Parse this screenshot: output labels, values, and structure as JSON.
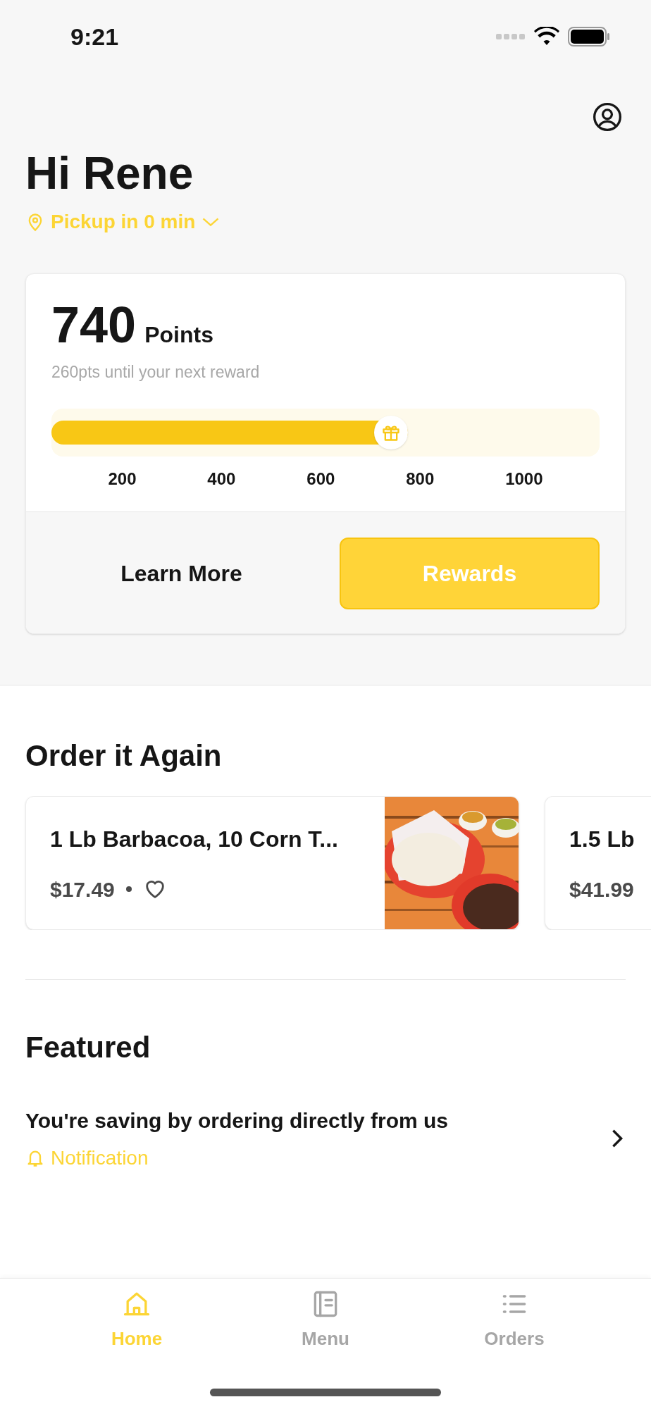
{
  "status_bar": {
    "time": "9:21"
  },
  "greeting": "Hi Rene",
  "pickup": {
    "label": "Pickup in 0 min"
  },
  "rewards_card": {
    "points": "740",
    "points_label": "Points",
    "subtitle": "260pts until your next reward",
    "ticks": [
      "200",
      "400",
      "600",
      "800",
      "1000"
    ],
    "buttons": [
      {
        "label": "Learn More",
        "kind": "plain"
      },
      {
        "label": "Rewards",
        "kind": "primary"
      }
    ]
  },
  "order_again": {
    "title": "Order it Again",
    "items": [
      {
        "name": "1 Lb Barbacoa, 10 Corn T...",
        "price": "$17.49",
        "favorite": false,
        "kind": "picture"
      },
      {
        "name": "1.5 Lb",
        "price": "$41.99"
      }
    ]
  },
  "featured": {
    "title": "Featured",
    "items": [
      {
        "title": "You're saving by ordering directly from us",
        "tag": "Notification"
      }
    ]
  },
  "tab_bar": [
    {
      "label": "Home",
      "selected": true,
      "kind": "home"
    },
    {
      "label": "Menu",
      "selected": false,
      "kind": "menu"
    },
    {
      "label": "Orders",
      "selected": false,
      "kind": "orders"
    }
  ]
}
